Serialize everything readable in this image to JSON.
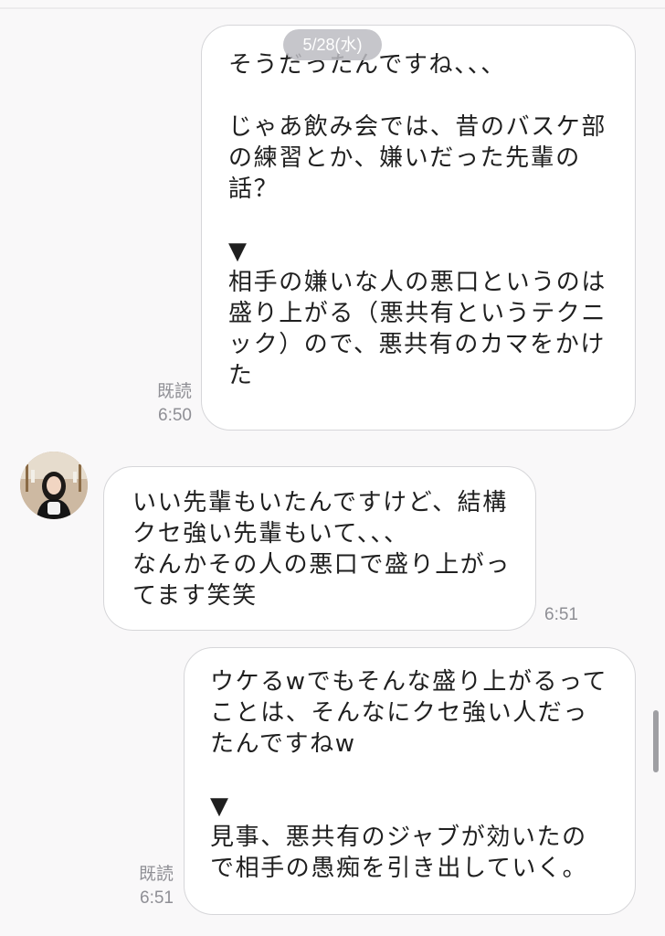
{
  "chat": {
    "date_label": "5/28(水)",
    "messages": [
      {
        "side": "outgoing",
        "text": "そうだったんですね、、、\n\nじゃあ飲み会では、昔のバスケ部\nの練習とか、嫌いだった先輩の\n話？\n\n▼\n相手の嫌いな人の悪口というのは\n盛り上がる（悪共有というテクニ\nック）ので、悪共有のカマをかけ\nた",
        "read": "既読",
        "time": "6:50"
      },
      {
        "side": "incoming",
        "text": "いい先輩もいたんですけど、結構\nクセ強い先輩もいて、、、\nなんかその人の悪口で盛り上がっ\nてます笑笑",
        "time": "6:51"
      },
      {
        "side": "outgoing",
        "text": "ウケるwでもそんな盛り上がるって\nことは、そんなにクセ強い人だっ\nたんですねw\n\n▼\n見事、悪共有のジャブが効いたの\nで相手の愚痴を引き出していく。",
        "read": "既読",
        "time": "6:51"
      }
    ]
  },
  "colors": {
    "background": "#f9f8f9",
    "bubble": "#ffffff",
    "bubble_border": "#d6d6d9",
    "meta_text": "#8f8f95",
    "date_pill": "#bcbcc2"
  }
}
